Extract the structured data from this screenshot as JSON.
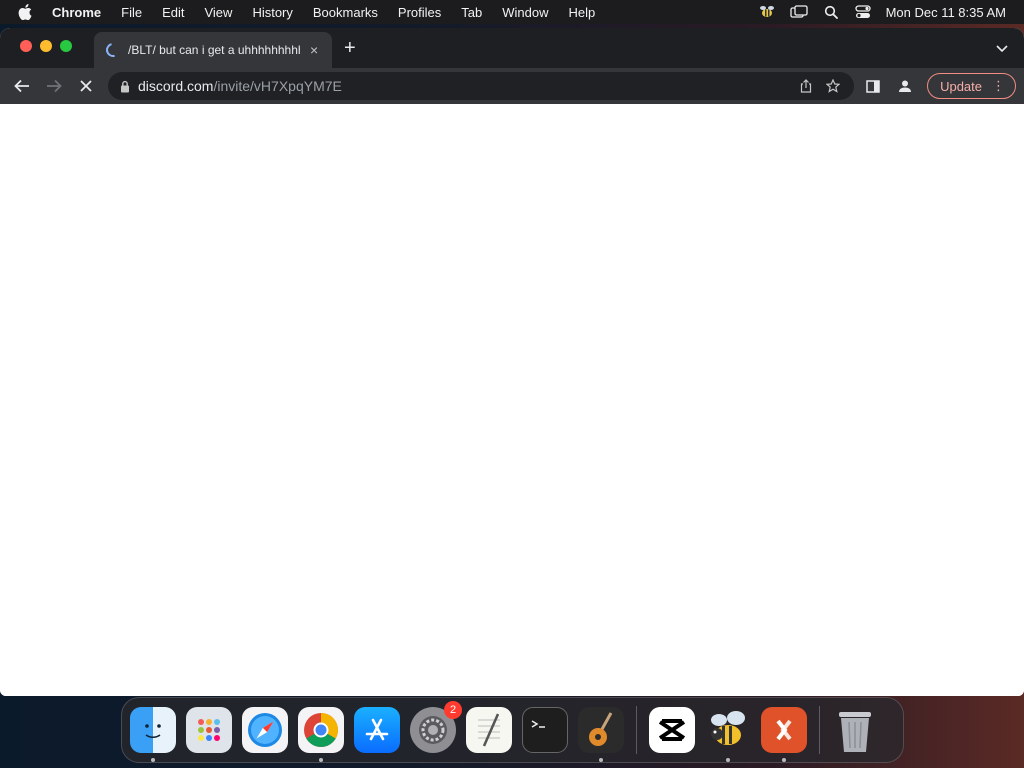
{
  "menubar": {
    "app_name": "Chrome",
    "items": [
      "File",
      "Edit",
      "View",
      "History",
      "Bookmarks",
      "Profiles",
      "Tab",
      "Window",
      "Help"
    ],
    "clock": "Mon Dec 11  8:35 AM"
  },
  "browser": {
    "tab_title": "/BLT/ but can i get a uhhhhhhhhhh",
    "new_tab": "+",
    "tab_close": "×",
    "url_host": "discord.com",
    "url_path": "/invite/vH7XpqYM7E",
    "update_label": "Update",
    "menu_dots": "⋮"
  },
  "dock": {
    "apps": [
      "Finder",
      "Launchpad",
      "Safari",
      "Google Chrome",
      "App Store",
      "System Settings",
      "TextEdit",
      "Terminal",
      "GarageBand",
      "CapCut",
      "Cyberduck",
      "Microsoft Remote Desktop",
      "Trash"
    ],
    "settings_badge": "2"
  }
}
